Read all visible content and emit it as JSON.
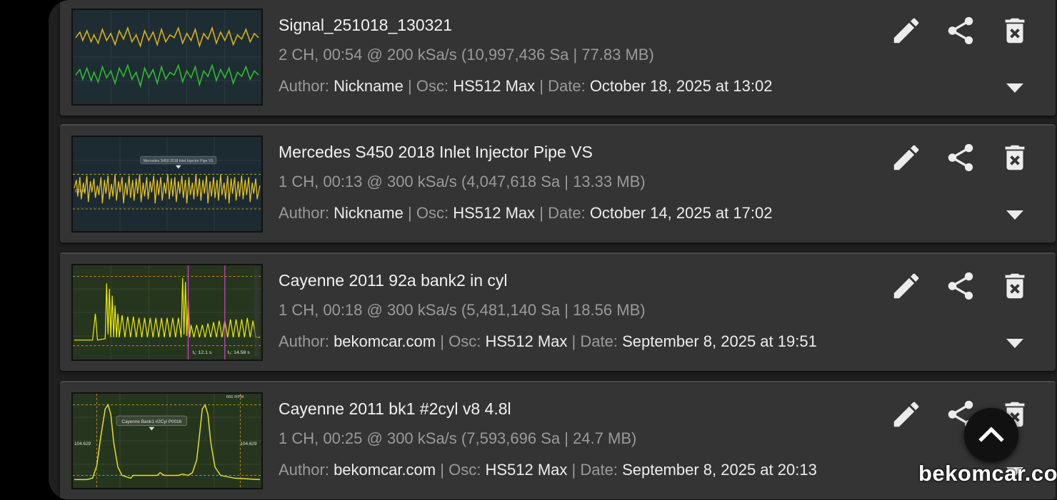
{
  "recordings": [
    {
      "title": "Signal_251018_130321",
      "specs": "2 CH, 00:54 @ 200 kSa/s (10,997,436 Sa | 77.83 MB)",
      "author_label": "Author:",
      "author": "Nickname",
      "osc_label": "| Osc:",
      "osc": "HS512 Max",
      "date_label": "| Date:",
      "date": "October 18, 2025 at 13:02",
      "thumb_colors": [
        "#d8b21e",
        "#2fbf2f"
      ]
    },
    {
      "title": "Mercedes S450 2018 Inlet Injector Pipe VS",
      "specs": "1 CH, 00:13 @ 300 kSa/s (4,047,618 Sa | 13.33 MB)",
      "author_label": "Author:",
      "author": "Nickname",
      "osc_label": "| Osc:",
      "osc": "HS512 Max",
      "date_label": "| Date:",
      "date": "October 14, 2025 at 17:02",
      "thumb_tooltip": "Mercedes S450 2018 Inlet Injector Pipe VS",
      "thumb_label": "0.006",
      "thumb_colors": [
        "#e6c21f"
      ]
    },
    {
      "title": "Cayenne 2011 92a bank2 in cyl",
      "specs": "1 CH, 00:18 @ 300 kSa/s (5,481,140 Sa | 18.56 MB)",
      "author_label": "Author:",
      "author": "bekomcar.com",
      "osc_label": "| Osc:",
      "osc": "HS512 Max",
      "date_label": "| Date:",
      "date": "September 8, 2025 at 19:51",
      "thumb_cursor1": "t₁: 12.1 s",
      "thumb_cursor2": "t₂: 14.58 s",
      "thumb_colors": [
        "#f0f000",
        "#d040d0"
      ]
    },
    {
      "title": "Cayenne 2011 bk1 #2cyl v8 4.8l",
      "specs": "1 CH, 00:25 @ 300 kSa/s (7,593,696 Sa | 24.7 MB)",
      "author_label": "Author:",
      "author": "bekomcar.com",
      "osc_label": "| Osc:",
      "osc": "HS512 Max",
      "date_label": "| Date:",
      "date": "September 8, 2025 at 20:13",
      "thumb_tooltip": "Cayenne Bank1 #2Cyl P0016",
      "thumb_left_value": "104.629",
      "thumb_right_value": "104.629",
      "thumb_top_label": "666 RPM",
      "thumb_colors": [
        "#e8e030"
      ]
    }
  ],
  "actions": {
    "edit_icon": "pencil-icon",
    "share_icon": "share-icon",
    "delete_icon": "delete-icon",
    "expand_icon": "caret-down-icon"
  },
  "fab": {
    "icon": "chevron-up-icon"
  },
  "watermark": "bekomcar.com"
}
